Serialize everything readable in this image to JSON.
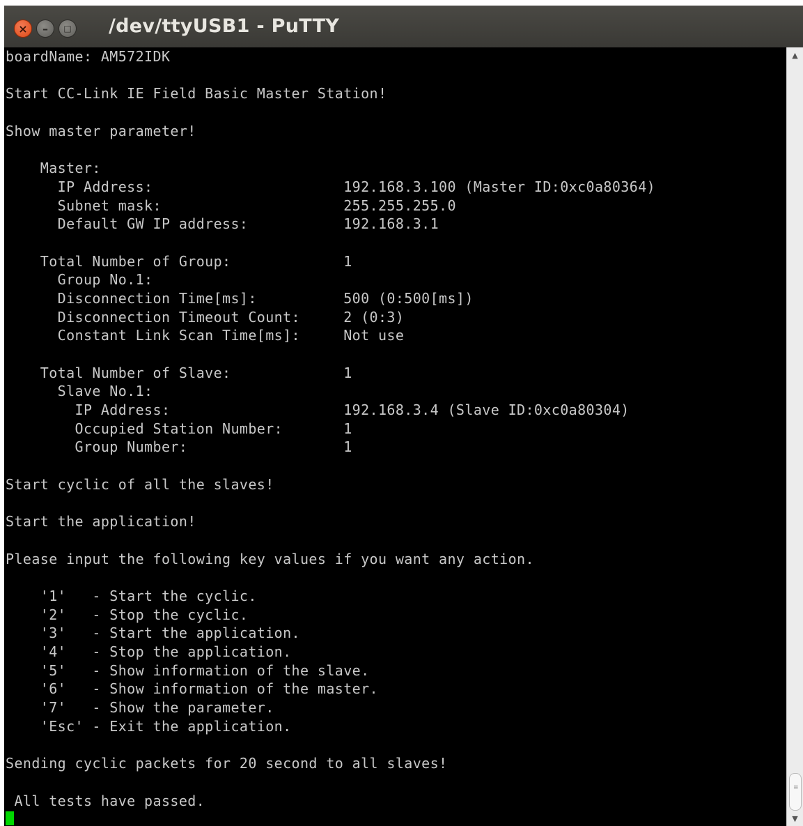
{
  "window": {
    "title": "/dev/ttyUSB1 - PuTTY",
    "close_glyph": "×",
    "min_glyph": "–",
    "max_glyph": "□"
  },
  "terminal": {
    "lines": [
      "boardName: AM572IDK",
      "",
      "Start CC-Link IE Field Basic Master Station!",
      "",
      "Show master parameter!",
      "",
      "    Master:",
      "      IP Address:                      192.168.3.100 (Master ID:0xc0a80364)",
      "      Subnet mask:                     255.255.255.0",
      "      Default GW IP address:           192.168.3.1",
      "",
      "    Total Number of Group:             1",
      "      Group No.1:",
      "      Disconnection Time[ms]:          500 (0:500[ms])",
      "      Disconnection Timeout Count:     2 (0:3)",
      "      Constant Link Scan Time[ms]:     Not use",
      "",
      "    Total Number of Slave:             1",
      "      Slave No.1:",
      "        IP Address:                    192.168.3.4 (Slave ID:0xc0a80304)",
      "        Occupied Station Number:       1",
      "        Group Number:                  1",
      "",
      "Start cyclic of all the slaves!",
      "",
      "Start the application!",
      "",
      "Please input the following key values if you want any action.",
      "",
      "    '1'   - Start the cyclic.",
      "    '2'   - Stop the cyclic.",
      "    '3'   - Start the application.",
      "    '4'   - Stop the application.",
      "    '5'   - Show information of the slave.",
      "    '6'   - Show information of the master.",
      "    '7'   - Show the parameter.",
      "    'Esc' - Exit the application.",
      "",
      "Sending cyclic packets for 20 second to all slaves!",
      "",
      " All tests have passed."
    ]
  },
  "scrollbar": {
    "up_glyph": "▲",
    "down_glyph": "▼",
    "grip_glyph": "≡"
  },
  "colors": {
    "terminal_bg": "#000000",
    "terminal_fg": "#c8c8c8",
    "cursor": "#00d800",
    "titlebar": "#3c3b37"
  }
}
